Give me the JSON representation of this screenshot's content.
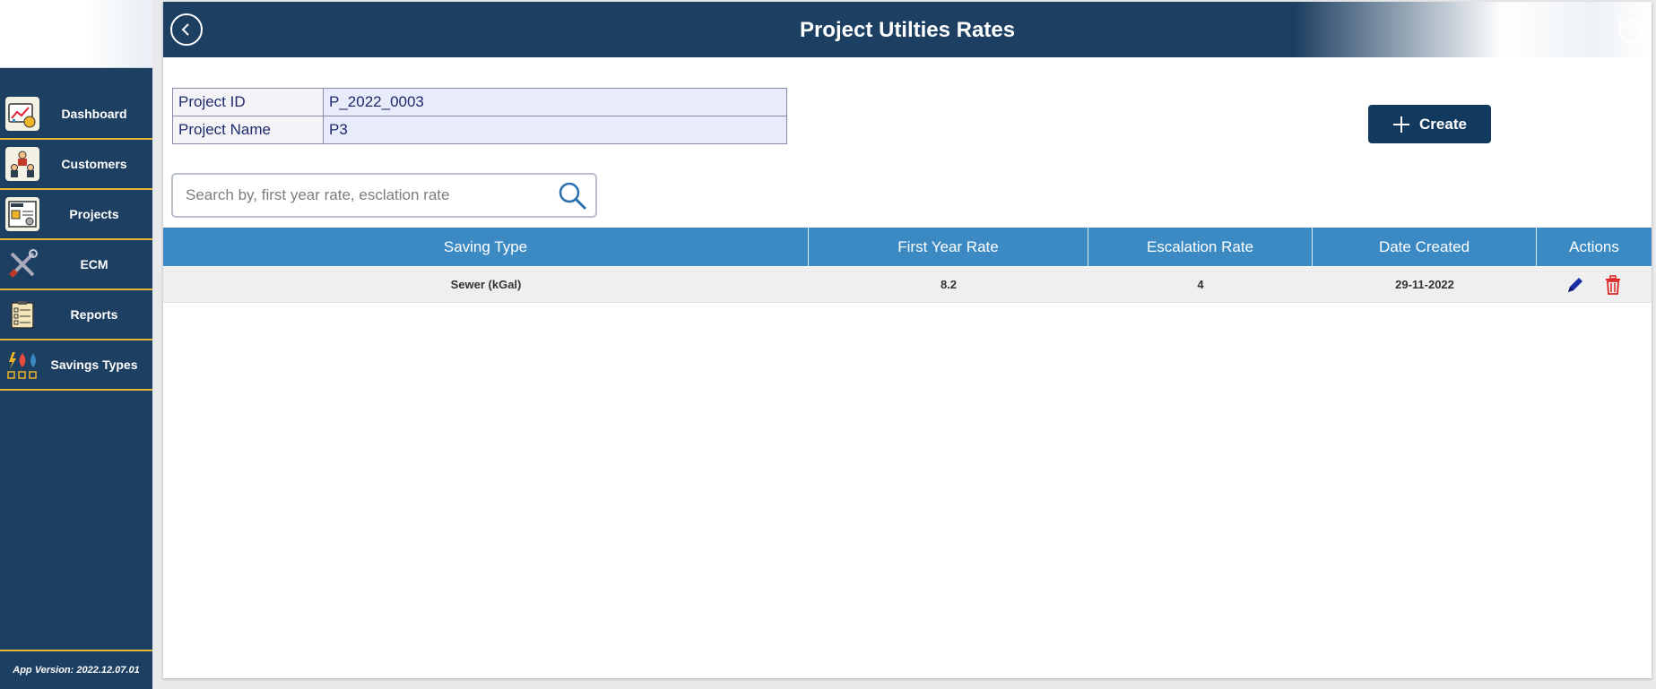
{
  "header": {
    "title": "Project Utilties Rates"
  },
  "sidebar": {
    "items": [
      {
        "label": "Dashboard"
      },
      {
        "label": "Customers"
      },
      {
        "label": "Projects"
      },
      {
        "label": "ECM"
      },
      {
        "label": "Reports"
      },
      {
        "label": "Savings Types"
      }
    ],
    "app_version": "App Version: 2022.12.07.01"
  },
  "project_info": {
    "id_label": "Project ID",
    "id_value": "P_2022_0003",
    "name_label": "Project Name",
    "name_value": "P3"
  },
  "create_button": {
    "label": "Create"
  },
  "search": {
    "placeholder": "Search by, first year rate, esclation rate",
    "value": ""
  },
  "grid": {
    "columns": [
      "Saving Type",
      "First Year Rate",
      "Escalation Rate",
      "Date Created",
      "Actions"
    ],
    "rows": [
      {
        "saving_type": "Sewer (kGal)",
        "first_year_rate": "8.2",
        "escalation_rate": "4",
        "date_created": "29-11-2022"
      }
    ]
  },
  "colors": {
    "navy": "#1d3f61",
    "accent_gold": "#e6b53a",
    "grid_header": "#3b8ac4",
    "edit": "#1a2fa8",
    "delete": "#e02424"
  },
  "icons": [
    "back-icon",
    "refresh-icon",
    "dashboard-icon",
    "customers-icon",
    "projects-icon",
    "ecm-tools-icon",
    "reports-icon",
    "savings-types-icon",
    "plus-icon",
    "search-icon",
    "edit-pencil-icon",
    "delete-trash-icon"
  ]
}
